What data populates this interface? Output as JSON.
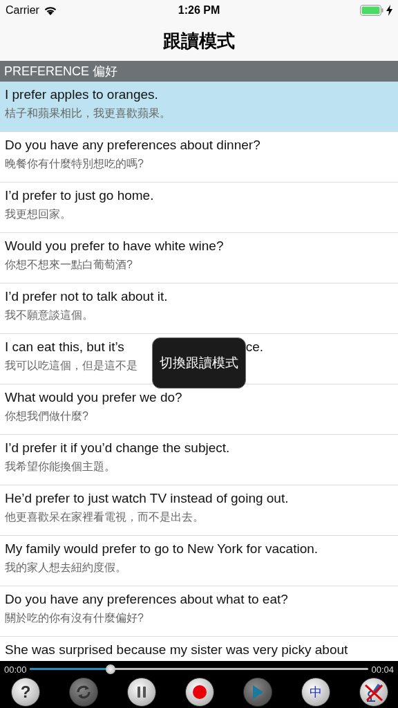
{
  "status_bar": {
    "carrier": "Carrier",
    "time": "1:26 PM",
    "charging": true,
    "battery": {
      "level": 1
    }
  },
  "nav": {
    "title": "跟讀模式"
  },
  "section": {
    "title": "PREFERENCE 偏好"
  },
  "rows": [
    {
      "english": "I prefer apples to oranges.",
      "chinese": "桔子和蘋果相比，我更喜歡蘋果。",
      "selected": true
    },
    {
      "english": "Do you have any preferences about dinner?",
      "chinese": "晚餐你有什麼特別想吃的嗎?",
      "selected": false
    },
    {
      "english": "I’d prefer to just go home.",
      "chinese": "我更想回家。",
      "selected": false
    },
    {
      "english": "Would you prefer to have white wine?",
      "chinese": "你想不想來一點白葡萄酒?",
      "selected": false
    },
    {
      "english": "I’d prefer not to talk about it.",
      "chinese": "我不願意談這個。",
      "selected": false
    },
    {
      "english": "I can eat this, but it’s",
      "english_tail": "ce.",
      "chinese": "我可以吃這個，但是這不是",
      "selected": false
    },
    {
      "english": "What would you prefer we do?",
      "chinese": "你想我們做什麼?",
      "selected": false
    },
    {
      "english": "I’d prefer it if you’d change the subject.",
      "chinese": "我希望你能換個主題。",
      "selected": false
    },
    {
      "english": "He’d prefer to just watch TV instead of going out.",
      "chinese": "他更喜歡呆在家裡看電視，而不是出去。",
      "selected": false
    },
    {
      "english": "My family would prefer to go to New York for vacation.",
      "chinese": "我的家人想去紐約度假。",
      "selected": false
    },
    {
      "english": "Do you have any preferences about what to eat?",
      "chinese": "關於吃的你有沒有什麼偏好?",
      "selected": false
    },
    {
      "english": "She was surprised because my sister was very picky about",
      "selected": false
    }
  ],
  "toast": {
    "text": "切換跟讀模式"
  },
  "player": {
    "elapsed": "00:00",
    "total": "00:04",
    "progress": {
      "level": 0.24
    },
    "buttons": [
      {
        "kind": "help",
        "label": "?",
        "disabled": false
      },
      {
        "kind": "repeat",
        "disabled": true
      },
      {
        "kind": "pause",
        "disabled": false
      },
      {
        "kind": "record",
        "disabled": false
      },
      {
        "kind": "play",
        "disabled": true
      },
      {
        "kind": "chinese",
        "label": "中",
        "disabled": false
      },
      {
        "kind": "mic-off",
        "disabled": false
      }
    ]
  }
}
